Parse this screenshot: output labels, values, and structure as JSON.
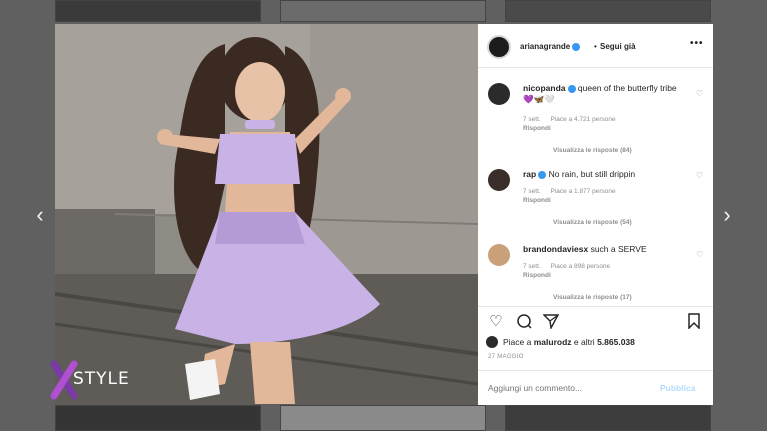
{
  "header": {
    "username": "arianagrande",
    "separator": "•",
    "follow_label": "Segui già",
    "more_label": "•••"
  },
  "comments": [
    {
      "user": "nicopanda",
      "text": "queen of the butterfly tribe 💜🦋🤍",
      "time": "7 sett.",
      "likes": "Piace a 4.721 persone",
      "reply": "Rispondi",
      "view_replies": "Visualizza le risposte (84)"
    },
    {
      "user": "rap",
      "text": "No rain, but still drippin",
      "time": "7 sett.",
      "likes": "Piace a 1.877 persone",
      "reply": "Rispondi",
      "view_replies": "Visualizza le risposte (54)"
    },
    {
      "user": "brandondaviesx",
      "text": "such a SERVE",
      "time": "7 sett.",
      "likes": "Piace a 898 persone",
      "reply": "Rispondi",
      "view_replies": "Visualizza le risposte (17)"
    }
  ],
  "likes_line": {
    "prefix": "Piace a",
    "user": "malurodz",
    "middle": "e altri",
    "count": "5.865.038"
  },
  "post_date": "27 MAGGIO",
  "add_comment": {
    "placeholder": "Aggiungi un commento...",
    "publish_label": "Pubblica"
  },
  "navigation": {
    "prev": "‹",
    "next": "›"
  },
  "logo": {
    "text": "STYLE"
  },
  "colors": {
    "dress": "#c9b3e6",
    "link_blue": "#3897f0",
    "logo_purple": "#7a3aa6"
  },
  "icons": [
    "heart-icon",
    "comment-icon",
    "share-icon",
    "bookmark-icon",
    "chevron-left-icon",
    "chevron-right-icon",
    "verified-badge-icon"
  ]
}
